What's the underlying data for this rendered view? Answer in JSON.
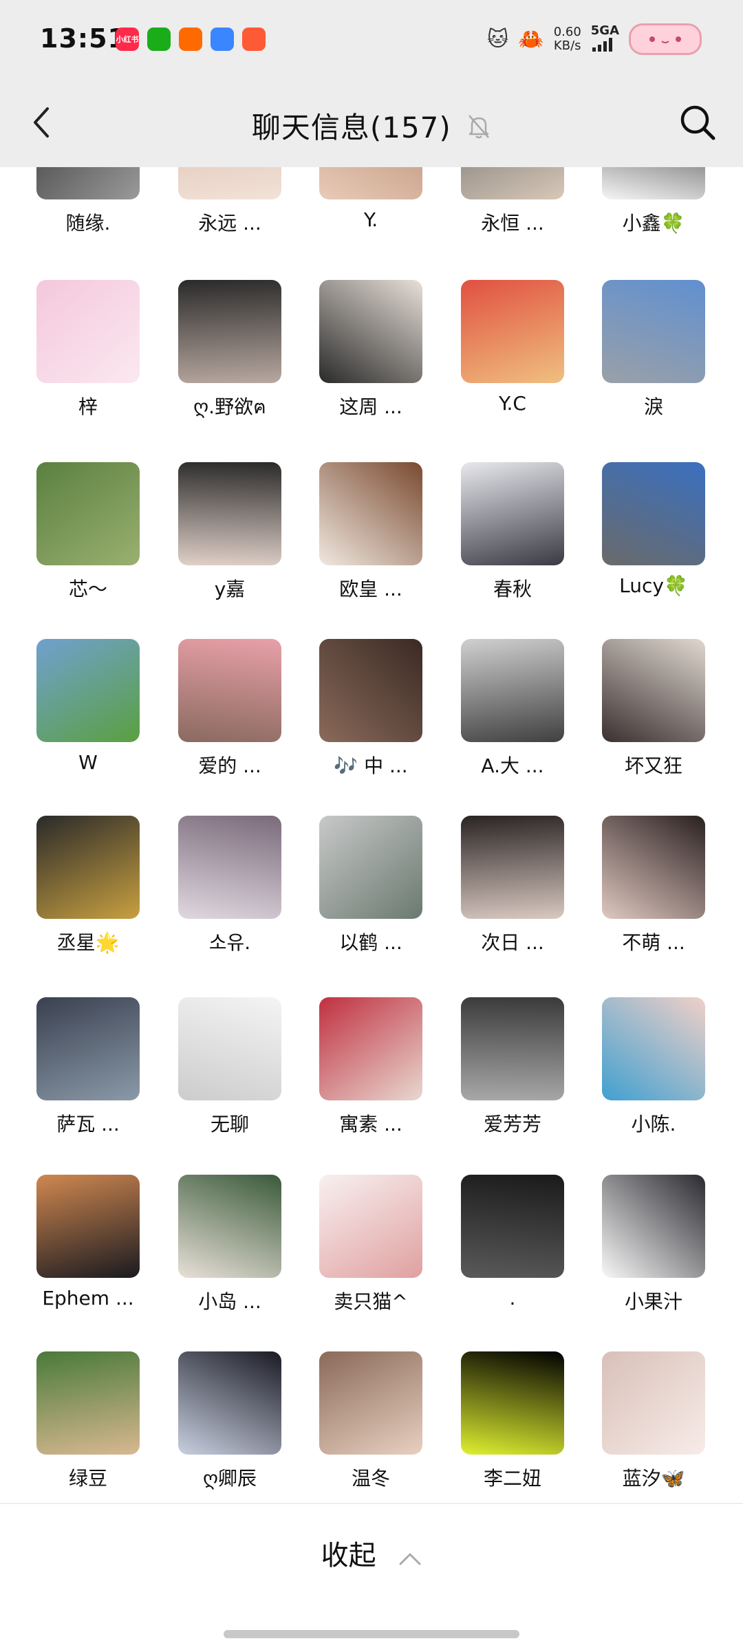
{
  "status_bar": {
    "time": "13:51",
    "speed_value": "0.60",
    "speed_unit": "KB/s",
    "network": "5GA",
    "apps": [
      {
        "name": "xiaohongshu-icon",
        "label": "小红书",
        "color": "#ff2a4a"
      },
      {
        "name": "wechat-icon",
        "label": "",
        "color": "#1aad19"
      },
      {
        "name": "kuaishou-icon",
        "label": "",
        "color": "#ff6a00"
      },
      {
        "name": "browser-icon",
        "label": "",
        "color": "#3a86ff"
      },
      {
        "name": "game-icon",
        "label": "",
        "color": "#ff5a36"
      }
    ]
  },
  "header": {
    "title": "聊天信息(157)",
    "back_icon": "chevron-left-icon",
    "search_icon": "search-icon",
    "mute_icon": "bell-off-icon"
  },
  "members": [
    {
      "name": "随缘.",
      "c1": "#3a3a3a",
      "c2": "#9a9a9a"
    },
    {
      "name": "永远 ...",
      "c1": "#d8b8a8",
      "c2": "#f2e2d8"
    },
    {
      "name": "Y.",
      "c1": "#b88a70",
      "c2": "#e8cbb8"
    },
    {
      "name": "永恒 ...",
      "c1": "#6a6a6a",
      "c2": "#d8c8b8"
    },
    {
      "name": "小鑫🍀",
      "c1": "#222222",
      "c2": "#f5f5f5"
    },
    {
      "name": "梓",
      "c1": "#f4c8dc",
      "c2": "#fbe8f0"
    },
    {
      "name": "ღ.野欲ฅ",
      "c1": "#2a2a2a",
      "c2": "#b8a8a0"
    },
    {
      "name": "这周 ...",
      "c1": "#e8e0d8",
      "c2": "#2a2a2a"
    },
    {
      "name": "Y.C",
      "c1": "#e05040",
      "c2": "#f0c080"
    },
    {
      "name": "淚",
      "c1": "#6090d0",
      "c2": "#9aa0a8"
    },
    {
      "name": "芯～",
      "c1": "#5a8040",
      "c2": "#9ab070"
    },
    {
      "name": "y嘉",
      "c1": "#2a2a2a",
      "c2": "#e0d0c8"
    },
    {
      "name": "欧皇 ...",
      "c1": "#7a4a30",
      "c2": "#f0e8e0"
    },
    {
      "name": "春秋",
      "c1": "#e8e8ee",
      "c2": "#3a3a44"
    },
    {
      "name": "Lucy🍀",
      "c1": "#3a70c0",
      "c2": "#6a6a6a"
    },
    {
      "name": "W",
      "c1": "#70a0d0",
      "c2": "#5aa040"
    },
    {
      "name": "爱的 ...",
      "c1": "#e8a0a8",
      "c2": "#8a6a60"
    },
    {
      "name": "🎶 中 ...",
      "c1": "#3a2a24",
      "c2": "#8a6a5a"
    },
    {
      "name": "A.大 ...",
      "c1": "#d0d0d0",
      "c2": "#404040"
    },
    {
      "name": "坏又狂",
      "c1": "#e0d8d0",
      "c2": "#3a3030"
    },
    {
      "name": "丞星🌟",
      "c1": "#2a2a2a",
      "c2": "#c8a040"
    },
    {
      "name": "소유.",
      "c1": "#7a6a7a",
      "c2": "#e0d8e0"
    },
    {
      "name": "以鹤 ...",
      "c1": "#c8c8c8",
      "c2": "#6a7a70"
    },
    {
      "name": "次日 ...",
      "c1": "#2a2424",
      "c2": "#d8c8c0"
    },
    {
      "name": "不萌 ...",
      "c1": "#2a2020",
      "c2": "#e0c8c0"
    },
    {
      "name": "萨瓦 ...",
      "c1": "#3a4050",
      "c2": "#8a9aa8"
    },
    {
      "name": "无聊",
      "c1": "#f4f4f4",
      "c2": "#cccccc"
    },
    {
      "name": "寓素 ...",
      "c1": "#c03040",
      "c2": "#e8d8d0"
    },
    {
      "name": "爱芳芳",
      "c1": "#3a3a3a",
      "c2": "#a8a8a8"
    },
    {
      "name": "小陈.",
      "c1": "#f0d0c8",
      "c2": "#40a0d0"
    },
    {
      "name": "Ephem ...",
      "c1": "#d08850",
      "c2": "#1a1a20"
    },
    {
      "name": "小岛 ...",
      "c1": "#3a5a3a",
      "c2": "#e8e0d8"
    },
    {
      "name": "卖只猫^",
      "c1": "#f8f0f0",
      "c2": "#e0a0a0"
    },
    {
      "name": ".",
      "c1": "#1a1a1a",
      "c2": "#5a5a5a"
    },
    {
      "name": "小果汁",
      "c1": "#2a2a30",
      "c2": "#f8f8f8"
    },
    {
      "name": "绿豆",
      "c1": "#4a7a3a",
      "c2": "#d8b890"
    },
    {
      "name": "ღ卿辰",
      "c1": "#1a1a24",
      "c2": "#c8d0e0"
    },
    {
      "name": "温冬",
      "c1": "#8a6a5a",
      "c2": "#e8d0c0"
    },
    {
      "name": "李二妞",
      "c1": "#000000",
      "c2": "#e0f030"
    },
    {
      "name": "蓝汐🦋",
      "c1": "#d8c0b8",
      "c2": "#f8ece8"
    }
  ],
  "footer": {
    "collapse_label": "收起",
    "chevron_icon": "chevron-up-icon"
  }
}
